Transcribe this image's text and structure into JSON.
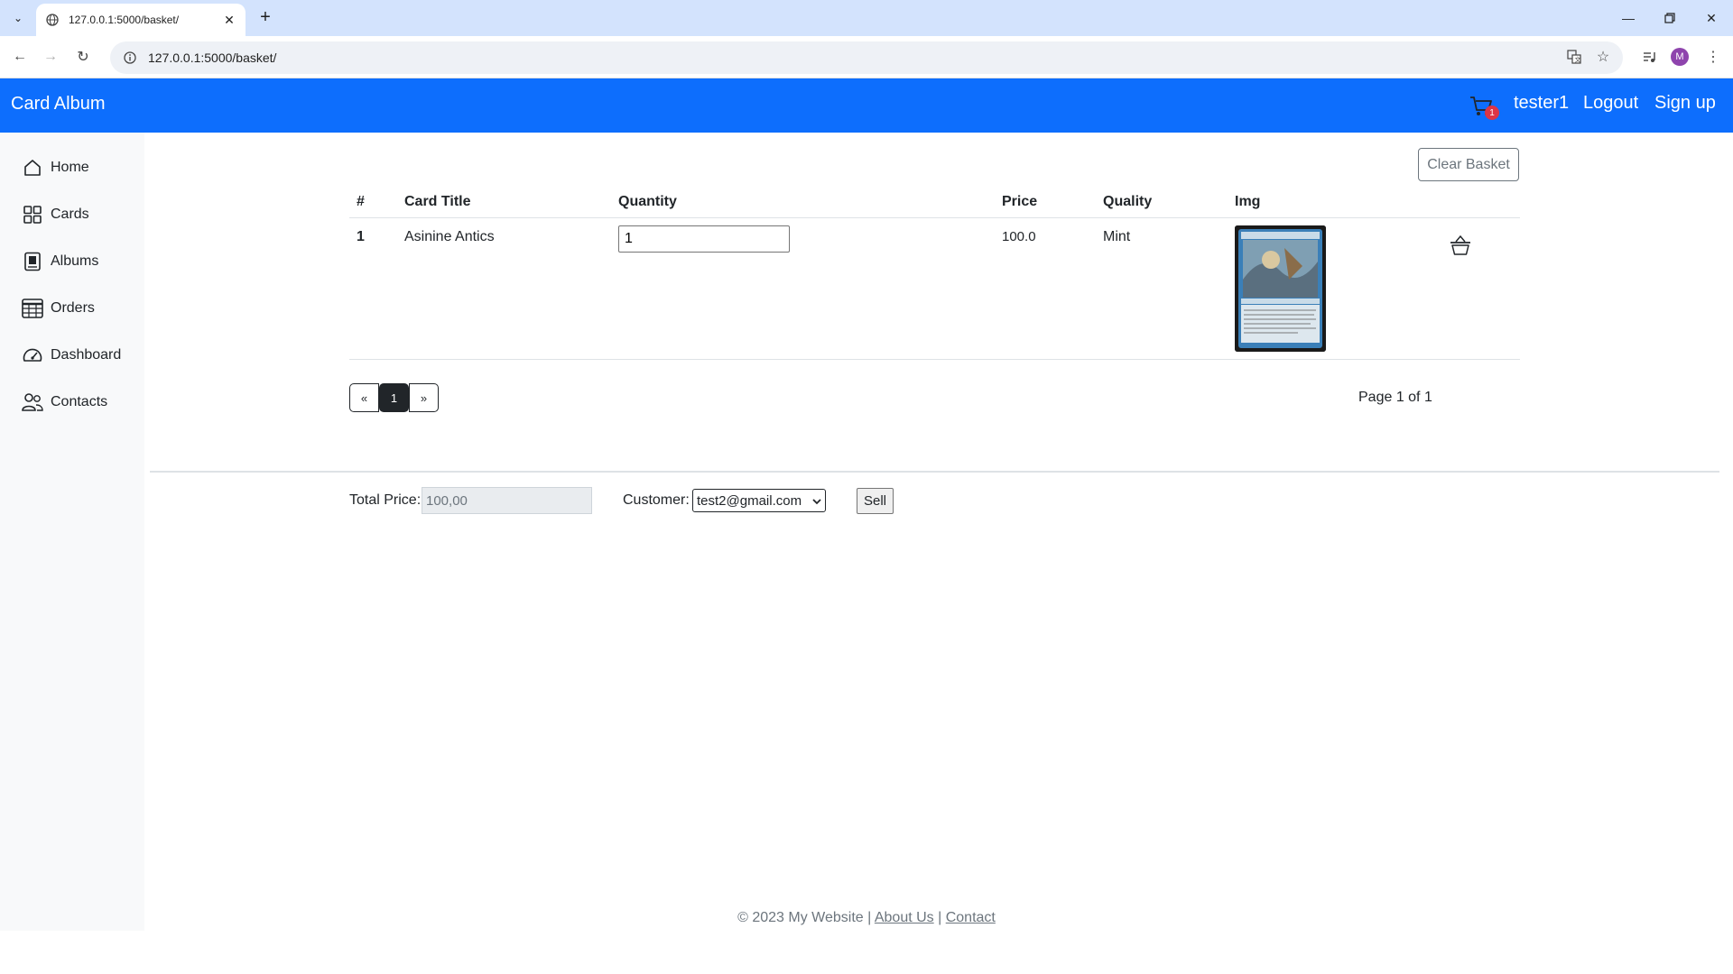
{
  "browser": {
    "tab_title": "127.0.0.1:5000/basket/",
    "url": "127.0.0.1:5000/basket/",
    "new_tab": "+",
    "profile_initial": "M"
  },
  "navbar": {
    "brand": "Card Album",
    "cart_count": "1",
    "user": "tester1",
    "logout": "Logout",
    "signup": "Sign up",
    "color": "#0d6efd"
  },
  "sidebar": {
    "items": [
      {
        "label": "Home",
        "icon": "house-icon"
      },
      {
        "label": "Cards",
        "icon": "grid-icon"
      },
      {
        "label": "Albums",
        "icon": "album-icon"
      },
      {
        "label": "Orders",
        "icon": "table-icon"
      },
      {
        "label": "Dashboard",
        "icon": "speedometer-icon"
      },
      {
        "label": "Contacts",
        "icon": "people-icon"
      }
    ]
  },
  "basket": {
    "clear_label": "Clear Basket",
    "columns": [
      "#",
      "Card Title",
      "Quantity",
      "Price",
      "Quality",
      "Img"
    ],
    "rows": [
      {
        "index": "1",
        "title": "Asinine Antics",
        "quantity": "1",
        "price": "100.0",
        "quality": "Mint"
      }
    ]
  },
  "pagination": {
    "prev": "«",
    "current": "1",
    "next": "»",
    "info": "Page 1 of 1"
  },
  "sale": {
    "total_label": "Total Price:",
    "total_value": "100,00",
    "customer_label": "Customer:",
    "customer_selected": "test2@gmail.com",
    "sell_label": "Sell"
  },
  "footer": {
    "copyright": "© 2023 My Website |",
    "about": "About Us",
    "sep": "|",
    "contact": "Contact"
  }
}
